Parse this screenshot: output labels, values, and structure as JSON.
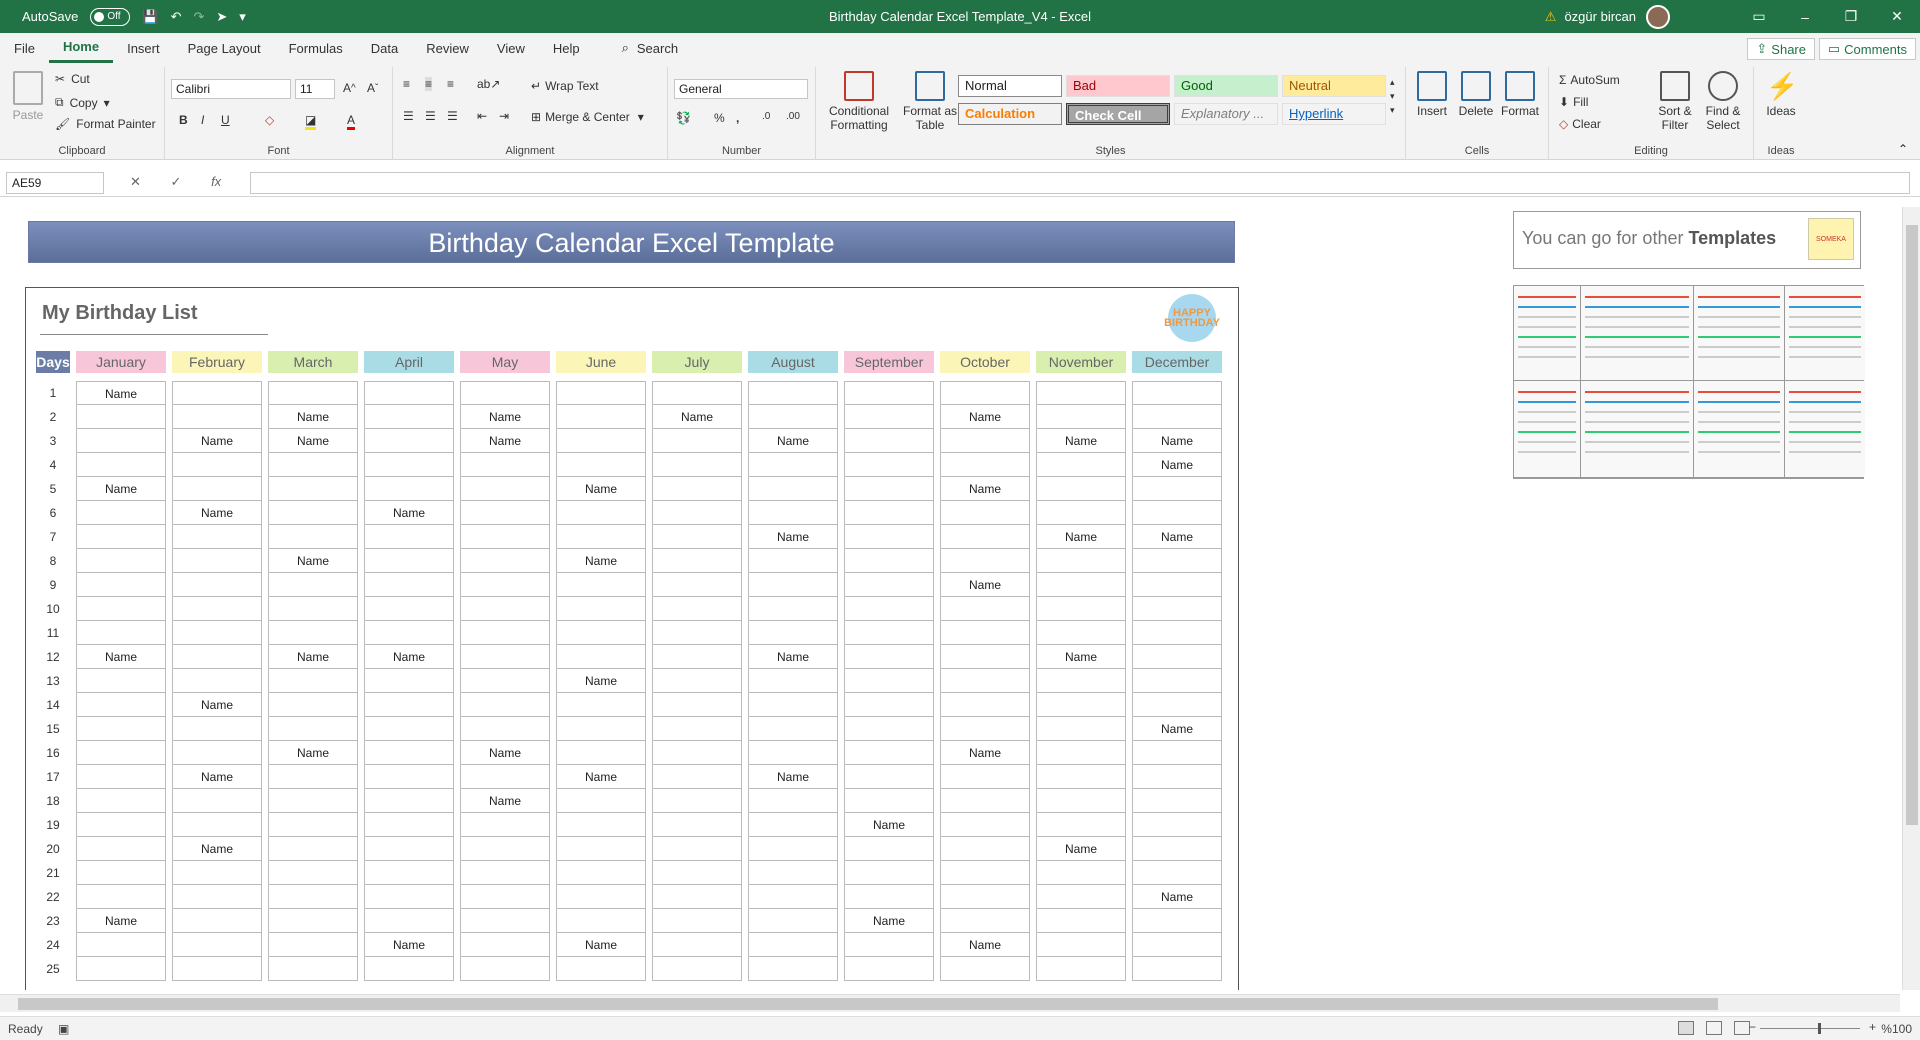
{
  "titlebar": {
    "autosave_label": "AutoSave",
    "autosave_state": "Off",
    "doc_title": "Birthday Calendar Excel Template_V4  -  Excel",
    "user_name": "özgür bircan",
    "minimize": "–",
    "restore": "❐",
    "close": "✕"
  },
  "menu": {
    "tabs": [
      "File",
      "Home",
      "Insert",
      "Page Layout",
      "Formulas",
      "Data",
      "Review",
      "View",
      "Help"
    ],
    "active": "Home",
    "search": "Search",
    "share": "Share",
    "comments": "Comments"
  },
  "ribbon": {
    "clipboard": {
      "label": "Clipboard",
      "paste": "Paste",
      "cut": "Cut",
      "copy": "Copy",
      "format_painter": "Format Painter"
    },
    "font": {
      "label": "Font",
      "family": "Calibri",
      "size": "11"
    },
    "alignment": {
      "label": "Alignment",
      "wrap_text": "Wrap Text",
      "merge_center": "Merge & Center"
    },
    "number": {
      "label": "Number",
      "format": "General"
    },
    "styles": {
      "label": "Styles",
      "conditional": "Conditional Formatting",
      "format_table": "Format as Table",
      "normal": "Normal",
      "bad": "Bad",
      "good": "Good",
      "neutral": "Neutral",
      "calculation": "Calculation",
      "check_cell": "Check Cell",
      "explanatory": "Explanatory ...",
      "hyperlink": "Hyperlink"
    },
    "cells": {
      "label": "Cells",
      "insert": "Insert",
      "delete": "Delete",
      "format": "Format"
    },
    "editing": {
      "label": "Editing",
      "autosum": "AutoSum",
      "fill": "Fill",
      "clear": "Clear",
      "sort_filter": "Sort & Filter",
      "find_select": "Find & Select"
    },
    "ideas": {
      "label": "Ideas",
      "ideas": "Ideas"
    },
    "colors": {
      "accent": "#217346",
      "bad_bg": "#ffc7ce",
      "good_bg": "#c6efce",
      "neutral_bg": "#ffeb9c"
    }
  },
  "formula": {
    "namebox": "AE59",
    "cancel": "✕",
    "enter": "✓",
    "fx": "fx",
    "value": ""
  },
  "sheet": {
    "banner": "Birthday Calendar Excel Template",
    "list_title": "My Birthday List",
    "logo_text": "HAPPY BIRTHDAY",
    "days_header": "Days",
    "months": [
      {
        "name": "January",
        "color": "#f7c6d9"
      },
      {
        "name": "February",
        "color": "#fbf6b8"
      },
      {
        "name": "March",
        "color": "#d8efb0"
      },
      {
        "name": "April",
        "color": "#aadce6"
      },
      {
        "name": "May",
        "color": "#f7c6d9"
      },
      {
        "name": "June",
        "color": "#fbf6b8"
      },
      {
        "name": "July",
        "color": "#d8efb0"
      },
      {
        "name": "August",
        "color": "#aadce6"
      },
      {
        "name": "September",
        "color": "#f7c6d9"
      },
      {
        "name": "October",
        "color": "#fbf6b8"
      },
      {
        "name": "November",
        "color": "#d8efb0"
      },
      {
        "name": "December",
        "color": "#aadce6"
      }
    ],
    "rows": [
      {
        "day": "1",
        "cells": [
          "Name",
          "",
          "",
          "",
          "",
          "",
          "",
          "",
          "",
          "",
          "",
          ""
        ]
      },
      {
        "day": "2",
        "cells": [
          "",
          "",
          "Name",
          "",
          "Name",
          "",
          "Name",
          "",
          "",
          "Name",
          "",
          ""
        ]
      },
      {
        "day": "3",
        "cells": [
          "",
          "Name",
          "Name",
          "",
          "Name",
          "",
          "",
          "Name",
          "",
          "",
          "Name",
          "Name"
        ]
      },
      {
        "day": "4",
        "cells": [
          "",
          "",
          "",
          "",
          "",
          "",
          "",
          "",
          "",
          "",
          "",
          "Name"
        ]
      },
      {
        "day": "5",
        "cells": [
          "Name",
          "",
          "",
          "",
          "",
          "Name",
          "",
          "",
          "",
          "Name",
          "",
          ""
        ]
      },
      {
        "day": "6",
        "cells": [
          "",
          "Name",
          "",
          "Name",
          "",
          "",
          "",
          "",
          "",
          "",
          "",
          ""
        ]
      },
      {
        "day": "7",
        "cells": [
          "",
          "",
          "",
          "",
          "",
          "",
          "",
          "Name",
          "",
          "",
          "Name",
          "Name"
        ]
      },
      {
        "day": "8",
        "cells": [
          "",
          "",
          "Name",
          "",
          "",
          "Name",
          "",
          "",
          "",
          "",
          "",
          ""
        ]
      },
      {
        "day": "9",
        "cells": [
          "",
          "",
          "",
          "",
          "",
          "",
          "",
          "",
          "",
          "Name",
          "",
          ""
        ]
      },
      {
        "day": "10",
        "cells": [
          "",
          "",
          "",
          "",
          "",
          "",
          "",
          "",
          "",
          "",
          "",
          ""
        ]
      },
      {
        "day": "11",
        "cells": [
          "",
          "",
          "",
          "",
          "",
          "",
          "",
          "",
          "",
          "",
          "",
          ""
        ]
      },
      {
        "day": "12",
        "cells": [
          "Name",
          "",
          "Name",
          "Name",
          "",
          "",
          "",
          "Name",
          "",
          "",
          "Name",
          ""
        ]
      },
      {
        "day": "13",
        "cells": [
          "",
          "",
          "",
          "",
          "",
          "Name",
          "",
          "",
          "",
          "",
          "",
          ""
        ]
      },
      {
        "day": "14",
        "cells": [
          "",
          "Name",
          "",
          "",
          "",
          "",
          "",
          "",
          "",
          "",
          "",
          ""
        ]
      },
      {
        "day": "15",
        "cells": [
          "",
          "",
          "",
          "",
          "",
          "",
          "",
          "",
          "",
          "",
          "",
          "Name"
        ]
      },
      {
        "day": "16",
        "cells": [
          "",
          "",
          "Name",
          "",
          "Name",
          "",
          "",
          "",
          "",
          "Name",
          "",
          ""
        ]
      },
      {
        "day": "17",
        "cells": [
          "",
          "Name",
          "",
          "",
          "",
          "Name",
          "",
          "Name",
          "",
          "",
          "",
          ""
        ]
      },
      {
        "day": "18",
        "cells": [
          "",
          "",
          "",
          "",
          "Name",
          "",
          "",
          "",
          "",
          "",
          "",
          ""
        ]
      },
      {
        "day": "19",
        "cells": [
          "",
          "",
          "",
          "",
          "",
          "",
          "",
          "",
          "Name",
          "",
          "",
          ""
        ]
      },
      {
        "day": "20",
        "cells": [
          "",
          "Name",
          "",
          "",
          "",
          "",
          "",
          "",
          "",
          "",
          "Name",
          ""
        ]
      },
      {
        "day": "21",
        "cells": [
          "",
          "",
          "",
          "",
          "",
          "",
          "",
          "",
          "",
          "",
          "",
          ""
        ]
      },
      {
        "day": "22",
        "cells": [
          "",
          "",
          "",
          "",
          "",
          "",
          "",
          "",
          "",
          "",
          "",
          "Name"
        ]
      },
      {
        "day": "23",
        "cells": [
          "Name",
          "",
          "",
          "",
          "",
          "",
          "",
          "",
          "Name",
          "",
          "",
          ""
        ]
      },
      {
        "day": "24",
        "cells": [
          "",
          "",
          "",
          "Name",
          "",
          "Name",
          "",
          "",
          "",
          "Name",
          "",
          ""
        ]
      },
      {
        "day": "25",
        "cells": [
          "",
          "",
          "",
          "",
          "",
          "",
          "",
          "",
          "",
          "",
          "",
          ""
        ]
      }
    ],
    "promo_text": "You can go for other ",
    "promo_bold": "Templates",
    "promo_logo": "SOMEKA"
  },
  "status": {
    "ready": "Ready",
    "zoom": "%100"
  }
}
